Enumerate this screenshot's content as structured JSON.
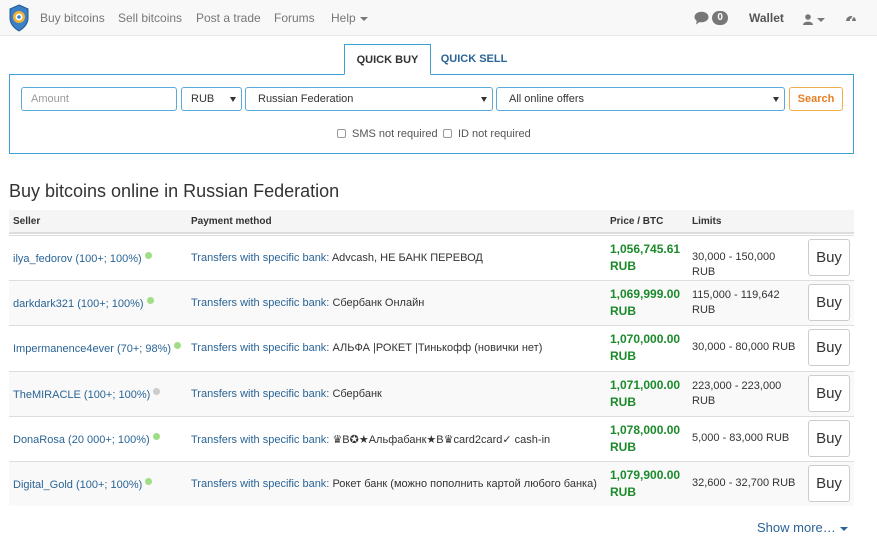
{
  "nav": {
    "links": [
      "Buy bitcoins",
      "Sell bitcoins",
      "Post a trade",
      "Forums",
      "Help"
    ],
    "messages_count": "0",
    "wallet_label": "Wallet"
  },
  "quick": {
    "tab_buy": "QUICK BUY",
    "tab_sell": "QUICK SELL",
    "amount_placeholder": "Amount",
    "currency": "RUB",
    "country": "Russian Federation",
    "offers": "All online offers",
    "search_label": "Search",
    "sms_label": "SMS not required",
    "id_label": "ID not required"
  },
  "heading": "Buy bitcoins online in Russian Federation",
  "table": {
    "headers": [
      "Seller",
      "Payment method",
      "Price / BTC",
      "Limits"
    ],
    "rows": [
      {
        "seller": "ilya_fedorov (100+; 100%)",
        "status": "online",
        "method": "Transfers with specific bank:",
        "desc": "Advcash, НЕ БАНК ПЕРЕВОД",
        "price": "1,056,745.61",
        "currency": "RUB",
        "limits": "30,000 - 150,000 RUB",
        "buy": "Buy"
      },
      {
        "seller": "darkdark321 (100+; 100%)",
        "status": "online",
        "method": "Transfers with specific bank:",
        "desc": "Сбербанк Онлайн",
        "price": "1,069,999.00",
        "currency": "RUB",
        "limits": "115,000 - 119,642 RUB",
        "buy": "Buy"
      },
      {
        "seller": "Impermanence4ever (70+; 98%)",
        "status": "online",
        "method": "Transfers with specific bank:",
        "desc": "АЛЬФА |РОКЕТ |Тинькофф (новички нет)",
        "price": "1,070,000.00",
        "currency": "RUB",
        "limits": "30,000 - 80,000 RUB",
        "buy": "Buy"
      },
      {
        "seller": "TheMIRACLE (100+; 100%)",
        "status": "away",
        "method": "Transfers with specific bank:",
        "desc": "Сбербанк",
        "price": "1,071,000.00",
        "currency": "RUB",
        "limits": "223,000 - 223,000 RUB",
        "buy": "Buy"
      },
      {
        "seller": "DonaRosa (20 000+; 100%)",
        "status": "online",
        "method": "Transfers with specific bank:",
        "desc": "♛B✪★Альфабанк★B♛card2card✓ cash-in",
        "price": "1,078,000.00",
        "currency": "RUB",
        "limits": "5,000 - 83,000 RUB",
        "buy": "Buy"
      },
      {
        "seller": "Digital_Gold (100+; 100%)",
        "status": "online",
        "method": "Transfers with specific bank:",
        "desc": "Рокет банк (можно пополнить картой любого банка)",
        "price": "1,079,900.00",
        "currency": "RUB",
        "limits": "32,600 - 32,700 RUB",
        "buy": "Buy"
      }
    ]
  },
  "show_more": "Show more…",
  "colors": {
    "link": "#2a6496",
    "price": "#1a8a2a",
    "accent_border": "#3c9fd6",
    "search_orange": "#e67e22",
    "online_dot": "#9fde86",
    "away_dot": "#cccccc"
  }
}
